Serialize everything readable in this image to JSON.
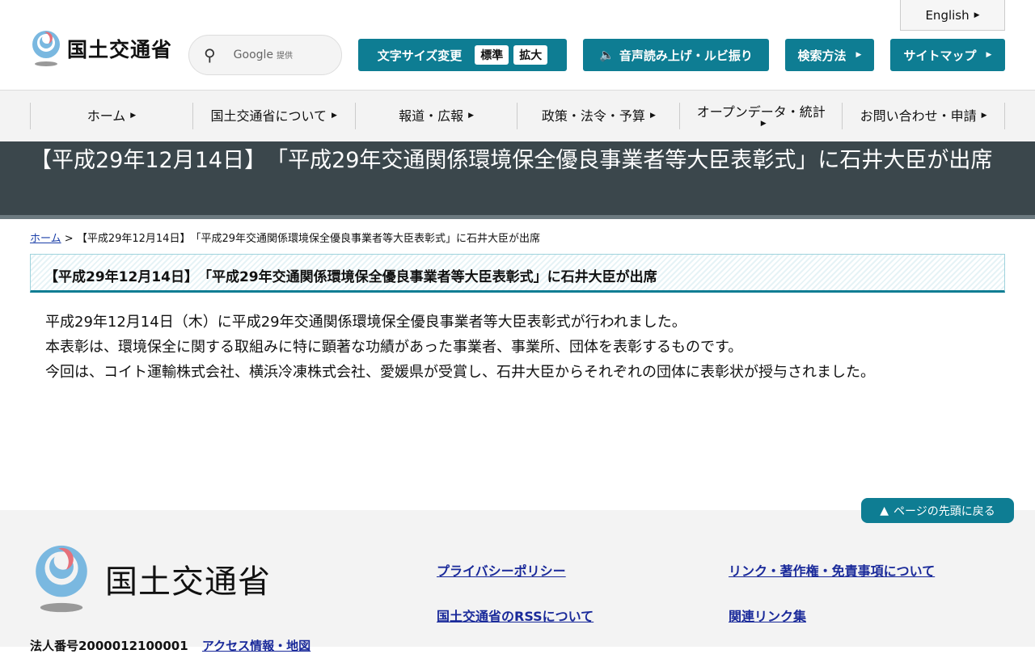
{
  "header": {
    "logo_text": "国土交通省",
    "search_brand": "Google",
    "search_provided": "提供",
    "english": "English",
    "font_size_label": "文字サイズ変更",
    "font_standard": "標準",
    "font_large": "拡大",
    "speech": "音声読み上げ・ルビ振り",
    "search_method": "検索方法",
    "sitemap": "サイトマップ"
  },
  "nav": [
    "ホーム",
    "国土交通省について",
    "報道・広報",
    "政策・法令・予算",
    "オープンデータ・統計",
    "お問い合わせ・申請"
  ],
  "banner_title": "【平成29年12月14日】　「平成29年交通関係環境保全優良事業者等大臣表彰式」に石井大臣が出席",
  "breadcrumb": {
    "home": "ホーム",
    "sep": ">",
    "current": "【平成29年12月14日】　「平成29年交通関係環境保全優良事業者等大臣表彰式」に石井大臣が出席"
  },
  "heading": "【平成29年12月14日】　「平成29年交通関係環境保全優良事業者等大臣表彰式」に石井大臣が出席",
  "body": [
    "平成29年12月14日（木）に平成29年交通関係環境保全優良事業者等大臣表彰式が行われました。",
    "本表彰は、環境保全に関する取組みに特に顕著な功績があった事業者、事業所、団体を表彰するものです。",
    "今回は、コイト運輸株式会社、横浜冷凍株式会社、愛媛県が受賞し、石井大臣からそれぞれの団体に表彰状が授与されました。"
  ],
  "back_to_top": "ページの先頭に戻る",
  "footer": {
    "logo_text": "国土交通省",
    "corp_number": "法人番号2000012100001",
    "access": "アクセス情報・地図",
    "links": [
      "プライバシーポリシー",
      "リンク・著作権・免責事項について",
      "国土交通省のRSSについて",
      "関連リンク集"
    ]
  }
}
